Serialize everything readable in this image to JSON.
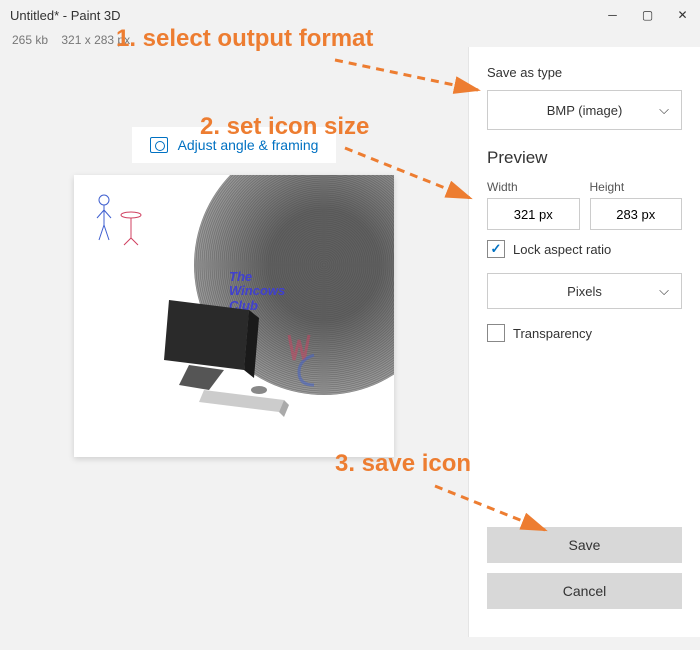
{
  "title": "Untitled* - Paint 3D",
  "status": {
    "size": "265 kb",
    "dims": "321 x 283 px"
  },
  "adjust_btn": "Adjust angle & framing",
  "watermark": {
    "l1": "The",
    "l2": "Wincows",
    "l3": "Club"
  },
  "sidebar": {
    "save_as_label": "Save as type",
    "format": "BMP (image)",
    "preview": "Preview",
    "width_label": "Width",
    "height_label": "Height",
    "width": "321 px",
    "height": "283 px",
    "lock_ratio": "Lock aspect ratio",
    "units": "Pixels",
    "transparency": "Transparency",
    "save": "Save",
    "cancel": "Cancel"
  },
  "annotations": {
    "a1": "1. select output format",
    "a2": "2. set icon size",
    "a3": "3. save icon"
  }
}
